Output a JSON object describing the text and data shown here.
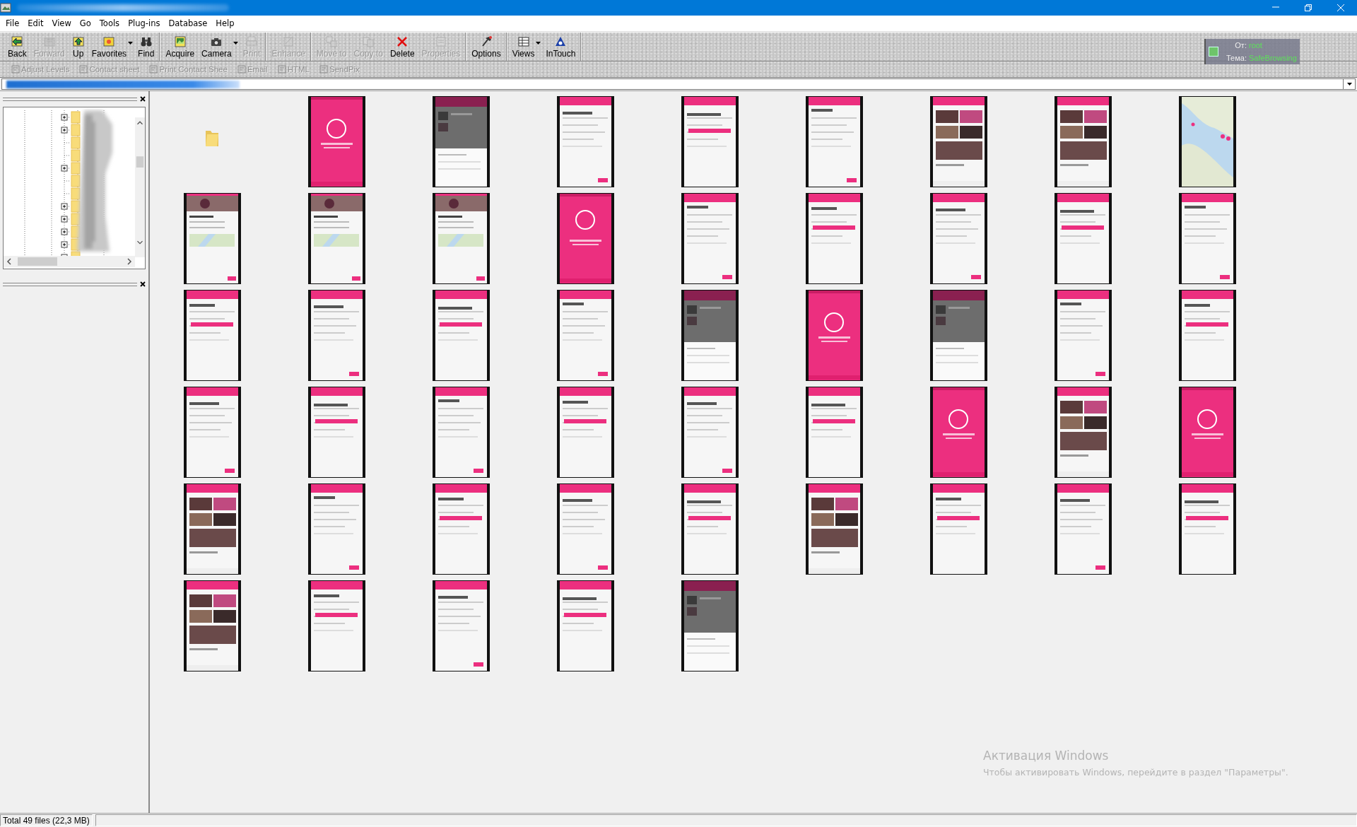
{
  "menu": [
    "File",
    "Edit",
    "View",
    "Go",
    "Tools",
    "Plug-ins",
    "Database",
    "Help"
  ],
  "toolbar": {
    "groups": [
      {
        "buttons": [
          {
            "label": "Back",
            "disabled": false,
            "has_menu": false
          },
          {
            "label": "Forward",
            "disabled": true,
            "has_menu": false
          },
          {
            "label": "Up",
            "disabled": false,
            "has_menu": false
          },
          {
            "label": "Favorites",
            "disabled": false,
            "has_menu": true
          },
          {
            "label": "Find",
            "disabled": false,
            "has_menu": false
          }
        ]
      },
      {
        "buttons": [
          {
            "label": "Acquire",
            "disabled": false,
            "has_menu": false
          },
          {
            "label": "Camera",
            "disabled": false,
            "has_menu": true
          },
          {
            "label": "Print",
            "disabled": true,
            "has_menu": false
          }
        ]
      },
      {
        "buttons": [
          {
            "label": "Enhance",
            "disabled": true,
            "has_menu": false
          }
        ]
      },
      {
        "buttons": [
          {
            "label": "Move to",
            "disabled": true,
            "has_menu": false
          },
          {
            "label": "Copy to",
            "disabled": true,
            "has_menu": false
          },
          {
            "label": "Delete",
            "disabled": false,
            "has_menu": false
          },
          {
            "label": "Properties",
            "disabled": true,
            "has_menu": false
          }
        ]
      },
      {
        "buttons": [
          {
            "label": "Options",
            "disabled": false,
            "has_menu": false
          }
        ]
      },
      {
        "buttons": [
          {
            "label": "Views",
            "disabled": false,
            "has_menu": true
          },
          {
            "label": "InTouch",
            "disabled": false,
            "has_menu": false
          }
        ]
      }
    ]
  },
  "toolbar_2": [
    {
      "label": "Adjust Levels",
      "disabled": true
    },
    {
      "label": "Contact sheet",
      "disabled": true
    },
    {
      "label": "Print Contact Shee",
      "disabled": true
    },
    {
      "label": "Email",
      "disabled": true
    },
    {
      "label": "HTML",
      "disabled": true
    },
    {
      "label": "SendPix",
      "disabled": true
    }
  ],
  "notification": {
    "from_label": "От:",
    "from": "root",
    "subject_label": "Тема:",
    "subject": "SafeBrowsing"
  },
  "files": [
    {
      "kind": "folder"
    },
    {
      "kind": "picture"
    },
    {
      "kind": "picture"
    },
    {
      "kind": "picture"
    },
    {
      "kind": "picture"
    },
    {
      "kind": "picture"
    },
    {
      "kind": "picture"
    },
    {
      "kind": "picture"
    },
    {
      "kind": "picture"
    },
    {
      "kind": "picture"
    },
    {
      "kind": "picture"
    },
    {
      "kind": "picture"
    },
    {
      "kind": "picture"
    },
    {
      "kind": "picture"
    },
    {
      "kind": "picture"
    },
    {
      "kind": "picture"
    },
    {
      "kind": "picture"
    },
    {
      "kind": "picture"
    },
    {
      "kind": "picture"
    },
    {
      "kind": "picture"
    },
    {
      "kind": "picture"
    },
    {
      "kind": "picture"
    },
    {
      "kind": "picture"
    },
    {
      "kind": "picture"
    },
    {
      "kind": "picture"
    },
    {
      "kind": "picture"
    },
    {
      "kind": "picture"
    },
    {
      "kind": "picture"
    },
    {
      "kind": "picture"
    },
    {
      "kind": "picture"
    },
    {
      "kind": "picture"
    },
    {
      "kind": "picture"
    },
    {
      "kind": "picture"
    },
    {
      "kind": "picture"
    },
    {
      "kind": "picture"
    },
    {
      "kind": "picture"
    },
    {
      "kind": "picture"
    },
    {
      "kind": "picture"
    },
    {
      "kind": "picture"
    },
    {
      "kind": "picture"
    },
    {
      "kind": "picture"
    },
    {
      "kind": "picture"
    },
    {
      "kind": "picture"
    },
    {
      "kind": "picture"
    },
    {
      "kind": "picture"
    },
    {
      "kind": "picture"
    },
    {
      "kind": "picture"
    },
    {
      "kind": "picture"
    },
    {
      "kind": "picture"
    },
    {
      "kind": "picture"
    }
  ],
  "activation": {
    "title": "Активация Windows",
    "message": "Чтобы активировать Windows, перейдите в раздел \"Параметры\"."
  },
  "status_bar": {
    "text": "Total 49 files (22,3 MB)"
  }
}
